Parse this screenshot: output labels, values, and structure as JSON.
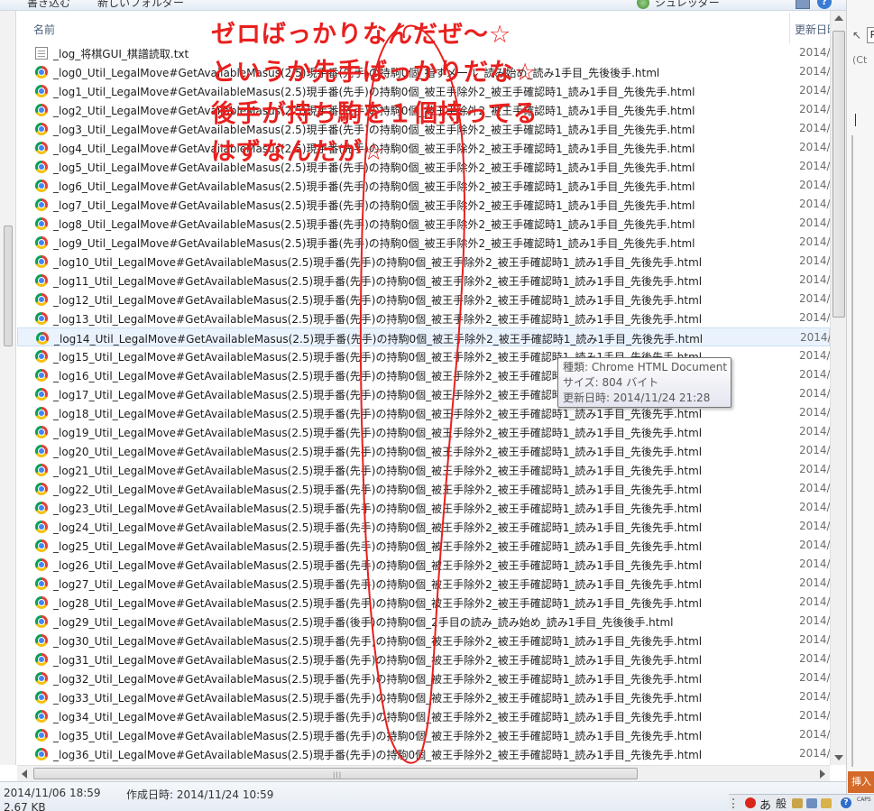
{
  "toolbar": {
    "buttons": [
      "書き込む",
      "新しいフォルダー",
      "シュレッダー"
    ]
  },
  "header": {
    "name_col": "名前",
    "date_col": "更新日時"
  },
  "files": [
    {
      "name": "_log_将棋GUI_棋譜読取.txt",
      "date": "2014/",
      "icon": "text-file-icon"
    },
    {
      "name": "_log0_Util_LegalMove#GetAvailableMasus(2.5)現手番(先手)の持駒0個_指すメ一ル_読み始め_読み1手目_先後後手.html",
      "date": "2014/",
      "icon": "chrome-icon"
    },
    {
      "name": "_log1_Util_LegalMove#GetAvailableMasus(2.5)現手番(先手)の持駒0個_被王手除外2_被王手確認時1_読み1手目_先後先手.html",
      "date": "2014/",
      "icon": "chrome-icon"
    },
    {
      "name": "_log2_Util_LegalMove#GetAvailableMasus(2.5)現手番(先手)の持駒0個_被王手除外2_被王手確認時1_読み1手目_先後先手.html",
      "date": "2014/",
      "icon": "chrome-icon"
    },
    {
      "name": "_log3_Util_LegalMove#GetAvailableMasus(2.5)現手番(先手)の持駒0個_被王手除外2_被王手確認時1_読み1手目_先後先手.html",
      "date": "2014/",
      "icon": "chrome-icon"
    },
    {
      "name": "_log4_Util_LegalMove#GetAvailableMasus(2.5)現手番(先手)の持駒0個_被王手除外2_被王手確認時1_読み1手目_先後先手.html",
      "date": "2014/",
      "icon": "chrome-icon"
    },
    {
      "name": "_log5_Util_LegalMove#GetAvailableMasus(2.5)現手番(先手)の持駒0個_被王手除外2_被王手確認時1_読み1手目_先後先手.html",
      "date": "2014/",
      "icon": "chrome-icon"
    },
    {
      "name": "_log6_Util_LegalMove#GetAvailableMasus(2.5)現手番(先手)の持駒0個_被王手除外2_被王手確認時1_読み1手目_先後先手.html",
      "date": "2014/",
      "icon": "chrome-icon"
    },
    {
      "name": "_log7_Util_LegalMove#GetAvailableMasus(2.5)現手番(先手)の持駒0個_被王手除外2_被王手確認時1_読み1手目_先後先手.html",
      "date": "2014/",
      "icon": "chrome-icon"
    },
    {
      "name": "_log8_Util_LegalMove#GetAvailableMasus(2.5)現手番(先手)の持駒0個_被王手除外2_被王手確認時1_読み1手目_先後先手.html",
      "date": "2014/",
      "icon": "chrome-icon"
    },
    {
      "name": "_log9_Util_LegalMove#GetAvailableMasus(2.5)現手番(先手)の持駒0個_被王手除外2_被王手確認時1_読み1手目_先後先手.html",
      "date": "2014/",
      "icon": "chrome-icon"
    },
    {
      "name": "_log10_Util_LegalMove#GetAvailableMasus(2.5)現手番(先手)の持駒0個_被王手除外2_被王手確認時1_読み1手目_先後先手.html",
      "date": "2014/",
      "icon": "chrome-icon"
    },
    {
      "name": "_log11_Util_LegalMove#GetAvailableMasus(2.5)現手番(先手)の持駒0個_被王手除外2_被王手確認時1_読み1手目_先後先手.html",
      "date": "2014/",
      "icon": "chrome-icon"
    },
    {
      "name": "_log12_Util_LegalMove#GetAvailableMasus(2.5)現手番(先手)の持駒0個_被王手除外2_被王手確認時1_読み1手目_先後先手.html",
      "date": "2014/",
      "icon": "chrome-icon"
    },
    {
      "name": "_log13_Util_LegalMove#GetAvailableMasus(2.5)現手番(先手)の持駒0個_被王手除外2_被王手確認時1_読み1手目_先後先手.html",
      "date": "2014/",
      "icon": "chrome-icon"
    },
    {
      "name": "_log14_Util_LegalMove#GetAvailableMasus(2.5)現手番(先手)の持駒0個_被王手除外2_被王手確認時1_読み1手目_先後先手.html",
      "date": "2014/",
      "icon": "chrome-icon"
    },
    {
      "name": "_log15_Util_LegalMove#GetAvailableMasus(2.5)現手番(先手)の持駒0個_被王手除外2_被王手確認時1_読み1手目_先後先手.html",
      "date": "2014/",
      "icon": "chrome-icon"
    },
    {
      "name": "_log16_Util_LegalMove#GetAvailableMasus(2.5)現手番(先手)の持駒0個_被王手除外2_被王手確認時1_読み1手目_先後先手.html",
      "date": "2014/",
      "icon": "chrome-icon"
    },
    {
      "name": "_log17_Util_LegalMove#GetAvailableMasus(2.5)現手番(先手)の持駒0個_被王手除外2_被王手確認時1_読み1手目_先後先手.html",
      "date": "2014/",
      "icon": "chrome-icon"
    },
    {
      "name": "_log18_Util_LegalMove#GetAvailableMasus(2.5)現手番(先手)の持駒0個_被王手除外2_被王手確認時1_読み1手目_先後先手.html",
      "date": "2014/",
      "icon": "chrome-icon"
    },
    {
      "name": "_log19_Util_LegalMove#GetAvailableMasus(2.5)現手番(先手)の持駒0個_被王手除外2_被王手確認時1_読み1手目_先後先手.html",
      "date": "2014/",
      "icon": "chrome-icon"
    },
    {
      "name": "_log20_Util_LegalMove#GetAvailableMasus(2.5)現手番(先手)の持駒0個_被王手除外2_被王手確認時1_読み1手目_先後先手.html",
      "date": "2014/",
      "icon": "chrome-icon"
    },
    {
      "name": "_log21_Util_LegalMove#GetAvailableMasus(2.5)現手番(先手)の持駒0個_被王手除外2_被王手確認時1_読み1手目_先後先手.html",
      "date": "2014/",
      "icon": "chrome-icon"
    },
    {
      "name": "_log22_Util_LegalMove#GetAvailableMasus(2.5)現手番(先手)の持駒0個_被王手除外2_被王手確認時1_読み1手目_先後先手.html",
      "date": "2014/",
      "icon": "chrome-icon"
    },
    {
      "name": "_log23_Util_LegalMove#GetAvailableMasus(2.5)現手番(先手)の持駒0個_被王手除外2_被王手確認時1_読み1手目_先後先手.html",
      "date": "2014/",
      "icon": "chrome-icon"
    },
    {
      "name": "_log24_Util_LegalMove#GetAvailableMasus(2.5)現手番(先手)の持駒0個_被王手除外2_被王手確認時1_読み1手目_先後先手.html",
      "date": "2014/",
      "icon": "chrome-icon"
    },
    {
      "name": "_log25_Util_LegalMove#GetAvailableMasus(2.5)現手番(先手)の持駒0個_被王手除外2_被王手確認時1_読み1手目_先後先手.html",
      "date": "2014/",
      "icon": "chrome-icon"
    },
    {
      "name": "_log26_Util_LegalMove#GetAvailableMasus(2.5)現手番(先手)の持駒0個_被王手除外2_被王手確認時1_読み1手目_先後先手.html",
      "date": "2014/",
      "icon": "chrome-icon"
    },
    {
      "name": "_log27_Util_LegalMove#GetAvailableMasus(2.5)現手番(先手)の持駒0個_被王手除外2_被王手確認時1_読み1手目_先後先手.html",
      "date": "2014/",
      "icon": "chrome-icon"
    },
    {
      "name": "_log28_Util_LegalMove#GetAvailableMasus(2.5)現手番(先手)の持駒0個_被王手除外2_被王手確認時1_読み1手目_先後先手.html",
      "date": "2014/",
      "icon": "chrome-icon"
    },
    {
      "name": "_log29_Util_LegalMove#GetAvailableMasus(2.5)現手番(後手)の持駒0個_2手目の読み_読み始め_読み1手目_先後後手.html",
      "date": "2014/",
      "icon": "chrome-icon"
    },
    {
      "name": "_log30_Util_LegalMove#GetAvailableMasus(2.5)現手番(先手)の持駒0個_被王手除外2_被王手確認時1_読み1手目_先後先手.html",
      "date": "2014/",
      "icon": "chrome-icon"
    },
    {
      "name": "_log31_Util_LegalMove#GetAvailableMasus(2.5)現手番(先手)の持駒0個_被王手除外2_被王手確認時1_読み1手目_先後先手.html",
      "date": "2014/",
      "icon": "chrome-icon"
    },
    {
      "name": "_log32_Util_LegalMove#GetAvailableMasus(2.5)現手番(先手)の持駒0個_被王手除外2_被王手確認時1_読み1手目_先後先手.html",
      "date": "2014/",
      "icon": "chrome-icon"
    },
    {
      "name": "_log33_Util_LegalMove#GetAvailableMasus(2.5)現手番(先手)の持駒0個_被王手除外2_被王手確認時1_読み1手目_先後先手.html",
      "date": "2014/",
      "icon": "chrome-icon"
    },
    {
      "name": "_log34_Util_LegalMove#GetAvailableMasus(2.5)現手番(先手)の持駒0個_被王手除外2_被王手確認時1_読み1手目_先後先手.html",
      "date": "2014/",
      "icon": "chrome-icon"
    },
    {
      "name": "_log35_Util_LegalMove#GetAvailableMasus(2.5)現手番(先手)の持駒0個_被王手除外2_被王手確認時1_読み1手目_先後先手.html",
      "date": "2014/",
      "icon": "chrome-icon"
    },
    {
      "name": "_log36_Util_LegalMove#GetAvailableMasus(2.5)現手番(先手)の持駒0個_被王手除外2_被王手確認時1_読み1手目_先後先手.html",
      "date": "2014/",
      "icon": "chrome-icon"
    }
  ],
  "hover_row_index": 15,
  "tooltip": {
    "type": "種類: Chrome HTML Document",
    "size": "サイズ: 804 バイト",
    "modified": "更新日時: 2014/11/24 21:28"
  },
  "status": {
    "modified": "2014/11/06 18:59",
    "created": "作成日時: 2014/11/24 10:59",
    "size": "2.67 KB"
  },
  "right_panel": {
    "box_label": "P",
    "partial_text": "(Ct",
    "action_button": "挿入"
  },
  "taskbar": {
    "ime_mode": "あ",
    "ime_type": "般",
    "caps": "CAPS"
  },
  "annotation": {
    "color": "#e8201e",
    "lines": [
      "ゼロばっかりなんだぜ〜☆",
      "というか先手ばっかりだな☆",
      "後手が持ち駒を１個持ってる",
      "はずなんだが☆"
    ]
  }
}
